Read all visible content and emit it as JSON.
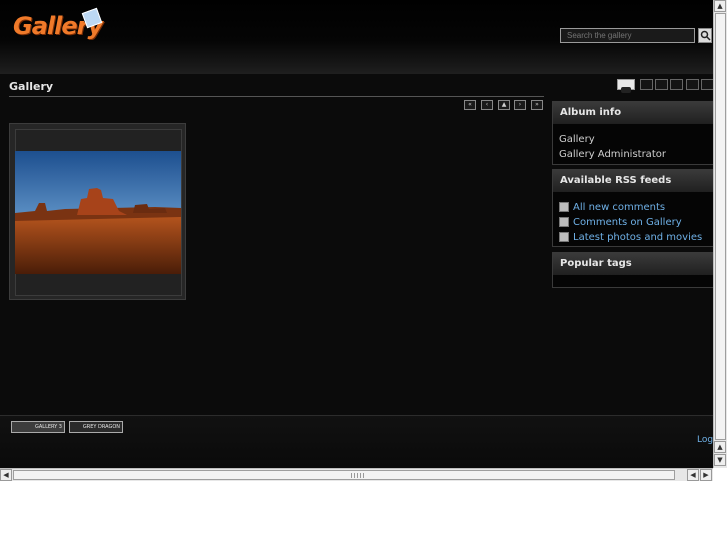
{
  "header": {
    "logo_text": "Gallery",
    "search": {
      "placeholder": "Search the gallery"
    }
  },
  "page": {
    "title": "Gallery"
  },
  "sidebar": {
    "album_info": {
      "title": "Album info",
      "lines": [
        "Gallery",
        "Gallery Administrator"
      ]
    },
    "rss": {
      "title": "Available RSS feeds",
      "items": [
        "All new comments",
        "Comments on Gallery",
        "Latest photos and movies"
      ]
    },
    "tags": {
      "title": "Popular tags"
    }
  },
  "footer": {
    "credit_gallery": "GALLERY 3",
    "credit_theme": "GREY DRAGON",
    "login": "Logi"
  },
  "colors": {
    "accent_link": "#6fb0e6",
    "logo": "#f07a2a",
    "background": "#0b0b0b"
  },
  "icons": [
    "search-icon",
    "slideshow-icon",
    "grid-view-icon",
    "first-page-icon",
    "previous-page-icon",
    "parent-album-icon",
    "next-page-icon",
    "last-page-icon",
    "rss-icon"
  ]
}
